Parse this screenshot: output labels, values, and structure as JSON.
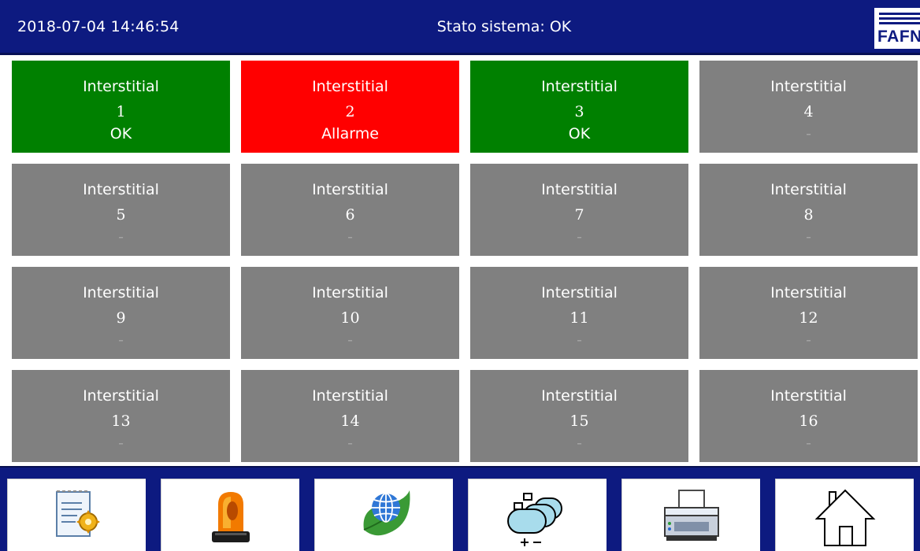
{
  "header": {
    "datetime": "2018-07-04  14:46:54",
    "status": "Stato sistema: OK",
    "logo_text": "FAFNIR"
  },
  "colors": {
    "header_bg": "#0d1a80",
    "ok": "#008000",
    "alarm": "#ff0000",
    "inactive": "#808080"
  },
  "tiles": [
    {
      "label": "Interstitial",
      "number": "1",
      "status": "OK",
      "state": "ok"
    },
    {
      "label": "Interstitial",
      "number": "2",
      "status": "Allarme",
      "state": "alarm"
    },
    {
      "label": "Interstitial",
      "number": "3",
      "status": "OK",
      "state": "ok"
    },
    {
      "label": "Interstitial",
      "number": "4",
      "status": "-",
      "state": "inactive"
    },
    {
      "label": "Interstitial",
      "number": "5",
      "status": "-",
      "state": "inactive"
    },
    {
      "label": "Interstitial",
      "number": "6",
      "status": "-",
      "state": "inactive"
    },
    {
      "label": "Interstitial",
      "number": "7",
      "status": "-",
      "state": "inactive"
    },
    {
      "label": "Interstitial",
      "number": "8",
      "status": "-",
      "state": "inactive"
    },
    {
      "label": "Interstitial",
      "number": "9",
      "status": "-",
      "state": "inactive"
    },
    {
      "label": "Interstitial",
      "number": "10",
      "status": "-",
      "state": "inactive"
    },
    {
      "label": "Interstitial",
      "number": "11",
      "status": "-",
      "state": "inactive"
    },
    {
      "label": "Interstitial",
      "number": "12",
      "status": "-",
      "state": "inactive"
    },
    {
      "label": "Interstitial",
      "number": "13",
      "status": "-",
      "state": "inactive"
    },
    {
      "label": "Interstitial",
      "number": "14",
      "status": "-",
      "state": "inactive"
    },
    {
      "label": "Interstitial",
      "number": "15",
      "status": "-",
      "state": "inactive"
    },
    {
      "label": "Interstitial",
      "number": "16",
      "status": "-",
      "state": "inactive"
    }
  ],
  "toolbar": [
    {
      "icon": "report-edit-icon"
    },
    {
      "icon": "alarm-beacon-icon"
    },
    {
      "icon": "globe-leaf-icon"
    },
    {
      "icon": "tanks-plus-minus-icon"
    },
    {
      "icon": "printer-icon"
    },
    {
      "icon": "home-icon"
    }
  ]
}
